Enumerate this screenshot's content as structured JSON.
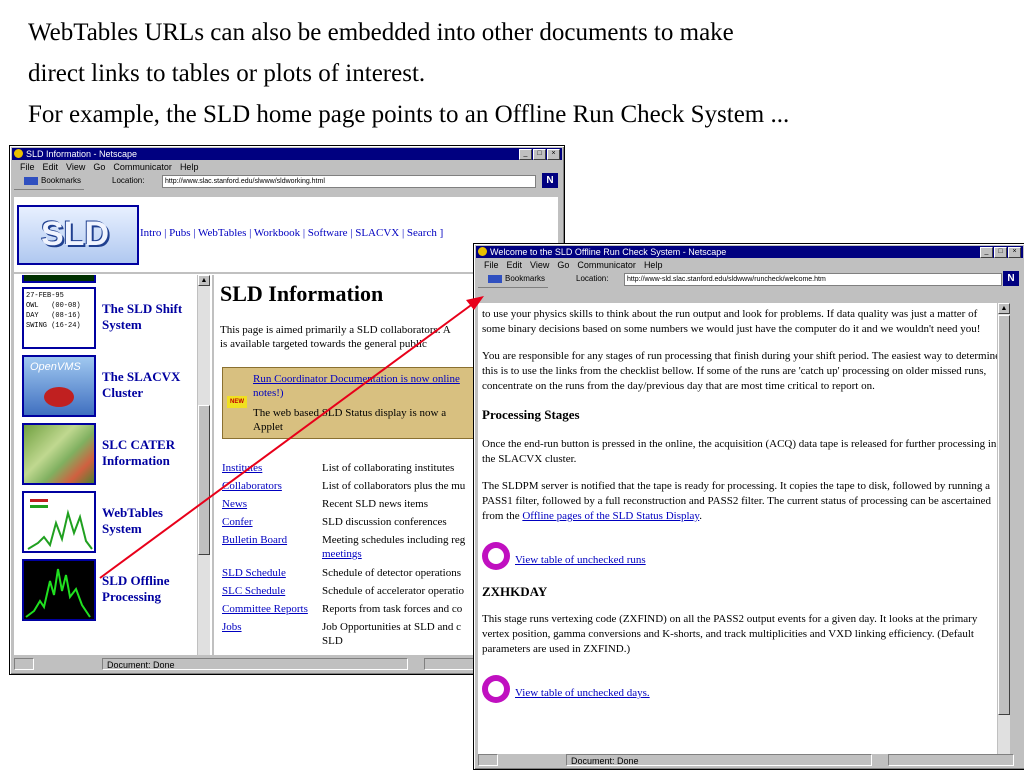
{
  "slide": {
    "line1": "WebTables URLs can also be embedded into other documents to make",
    "line2": "direct links to tables or plots of interest.",
    "line3": "For example, the SLD home page points to an Offline Run Check System ..."
  },
  "win1": {
    "title": "SLD Information - Netscape",
    "menu": [
      "File",
      "Edit",
      "View",
      "Go",
      "Communicator",
      "Help"
    ],
    "bookmarks": "Bookmarks",
    "location_label": "Location:",
    "url": "http://www.slac.stanford.edu/slwww/sldworking.html",
    "logo": "SLD",
    "navlinks": "Intro | Pubs | WebTables | Workbook | Software | SLACVX | Search ]",
    "sidebar": [
      {
        "label": "The SLD Shift System",
        "thumb": "27-FEB-95\nOWL   (00-08)\nDAY   (08-16)\nSWING (16-24)"
      },
      {
        "label": "The SLACVX Cluster",
        "thumb": "OpenVMS"
      },
      {
        "label": "SLC CATER Information",
        "thumb": ""
      },
      {
        "label": "WebTables System",
        "thumb": ""
      },
      {
        "label": "SLD Offline Processing",
        "thumb": ""
      }
    ],
    "heading": "SLD Information",
    "intro": "This page is aimed primarily a  SLD collaborators. A",
    "intro2": "is available targeted towards the general public",
    "news_badge": "NEW",
    "news1": "Run Coordinator Documentation is now online",
    "news1b": "notes!)",
    "news2": "The web based SLD Status display is now a",
    "news2b": "Applet",
    "table": [
      {
        "link": "Institutes",
        "desc": "List of collaborating institutes"
      },
      {
        "link": "Collaborators",
        "desc": "List of collaborators plus the mu"
      },
      {
        "link": "News",
        "desc": "Recent SLD news items"
      },
      {
        "link": "Confer",
        "desc": "SLD discussion conferences"
      },
      {
        "link": "Bulletin Board",
        "desc": "Meeting schedules including reg"
      },
      {
        "link": "",
        "desc": "meetings"
      },
      {
        "link": "SLD Schedule",
        "desc": "Schedule of detector operations"
      },
      {
        "link": "SLC Schedule",
        "desc": "Schedule of accelerator operatio"
      },
      {
        "link": "Committee Reports",
        "desc": "Reports from task forces and co"
      },
      {
        "link": "Jobs",
        "desc": "Job Opportunities at SLD and c"
      },
      {
        "link": "",
        "desc": "SLD"
      }
    ],
    "status": "Document: Done"
  },
  "win2": {
    "title": "Welcome to the SLD Offline Run Check System - Netscape",
    "menu": [
      "File",
      "Edit",
      "View",
      "Go",
      "Communicator",
      "Help"
    ],
    "bookmarks": "Bookmarks",
    "location_label": "Location:",
    "url": "http://www-sld.slac.stanford.edu/sldwww/runcheck/welcome.htm",
    "p1": "to use your physics skills to think about the run output and look for problems. If data quality was just a matter of some binary decisions based on some numbers we would just have the computer do it and we wouldn't need you!",
    "p2": "You are responsible for any stages of run processing that finish during your shift period. The easiest way to determine this is to use the links from the checklist bellow. If some of the runs are 'catch up' processing on older missed runs, concentrate on the runs from the day/previous day that are most time critical to report on.",
    "h_processing": "Processing Stages",
    "p3": "Once the end-run button is pressed in the online, the acquisition (ACQ) data tape is released for further processing in the SLACVX cluster.",
    "p4": "The SLDPM server is notified that the tape is ready for processing. It copies the tape to disk, followed by running a PASS1 filter, followed by a full reconstruction and PASS2 filter. The current status of processing can be ascertained from the ",
    "p4_link": "Offline pages of the SLD Status Display",
    "link_runs": "View table of unchecked runs",
    "h_zxhkday": "ZXHKDAY",
    "p5": "This stage runs vertexing code (ZXFIND) on all the PASS2 output events for a given day. It looks at the primary vertex position, gamma conversions and K-shorts, and track multiplicities and VXD linking efficiency. (Default parameters are used in ZXFIND.)",
    "link_days": "View table of unchecked days.",
    "status": "Document: Done"
  },
  "colors": {
    "titlebar": "#000080",
    "chrome": "#c0c0c0",
    "link": "#0000c0",
    "arrow": "#e8001a",
    "newsbox": "#d8c080"
  }
}
